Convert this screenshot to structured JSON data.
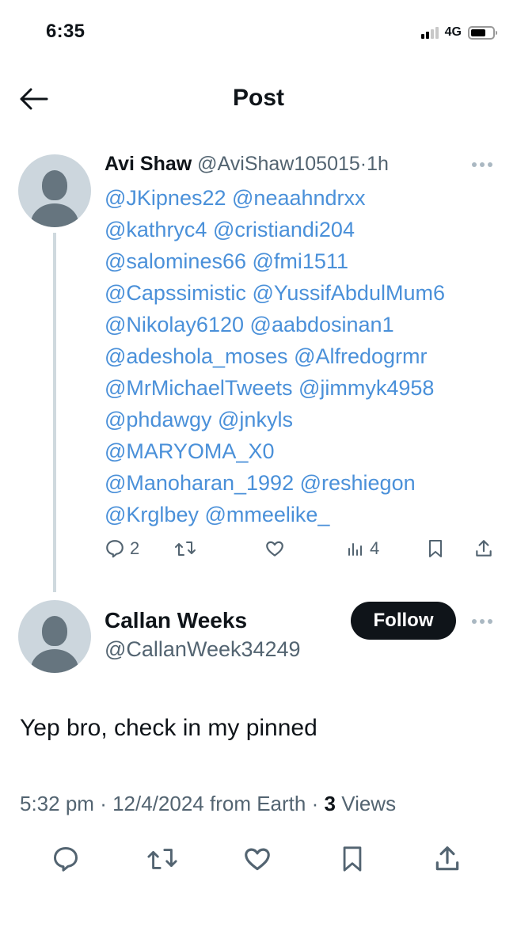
{
  "status_bar": {
    "time": "6:35",
    "network": "4G",
    "signal_bars_active": 2,
    "signal_bars_total": 4,
    "battery_level": 0.7
  },
  "nav": {
    "back_icon": "arrow-left-icon",
    "title": "Post"
  },
  "parent_tweet": {
    "author_name": "Avi Shaw",
    "author_handle": "@AviShaw105015",
    "separator": "·",
    "time_ago": "1h",
    "mention_lines": [
      [
        "@JKipnes22",
        "@neaahndrxx"
      ],
      [
        "@kathryc4",
        "@cristiandi204"
      ],
      [
        "@salomines66",
        "@fmi1511"
      ],
      [
        "@Capssimistic",
        "@YussifAbdulMum6"
      ],
      [
        "@Nikolay6120",
        "@aabdosinan1"
      ],
      [
        "@adeshola_moses",
        "@Alfredogrmr"
      ],
      [
        "@MrMichaelTweets",
        "@jimmyk4958"
      ],
      [
        "@phdawgy",
        "@jnkyls"
      ],
      [
        "@MARYOMA_X0"
      ],
      [
        "@Manoharan_1992",
        "@reshiegon"
      ],
      [
        "@Krglbey",
        "@mmeelike_"
      ]
    ],
    "actions": {
      "replies": "2",
      "reposts": "",
      "likes": "",
      "views": "4"
    },
    "colors": {
      "mention": "#4a90d9",
      "secondary": "#536471"
    }
  },
  "main_tweet": {
    "author_name": "Callan Weeks",
    "author_handle": "@CallanWeek34249",
    "follow_label": "Follow",
    "text": "Yep bro, check in my pinned",
    "time": "5:32 pm",
    "separator": "·",
    "date_source": "12/4/2024 from Earth",
    "views_count": "3",
    "views_label": "Views"
  },
  "icons": {
    "reply": "reply-icon",
    "repost": "repost-icon",
    "like": "heart-icon",
    "views": "analytics-icon",
    "bookmark": "bookmark-icon",
    "share": "share-icon",
    "more": "more-icon"
  }
}
